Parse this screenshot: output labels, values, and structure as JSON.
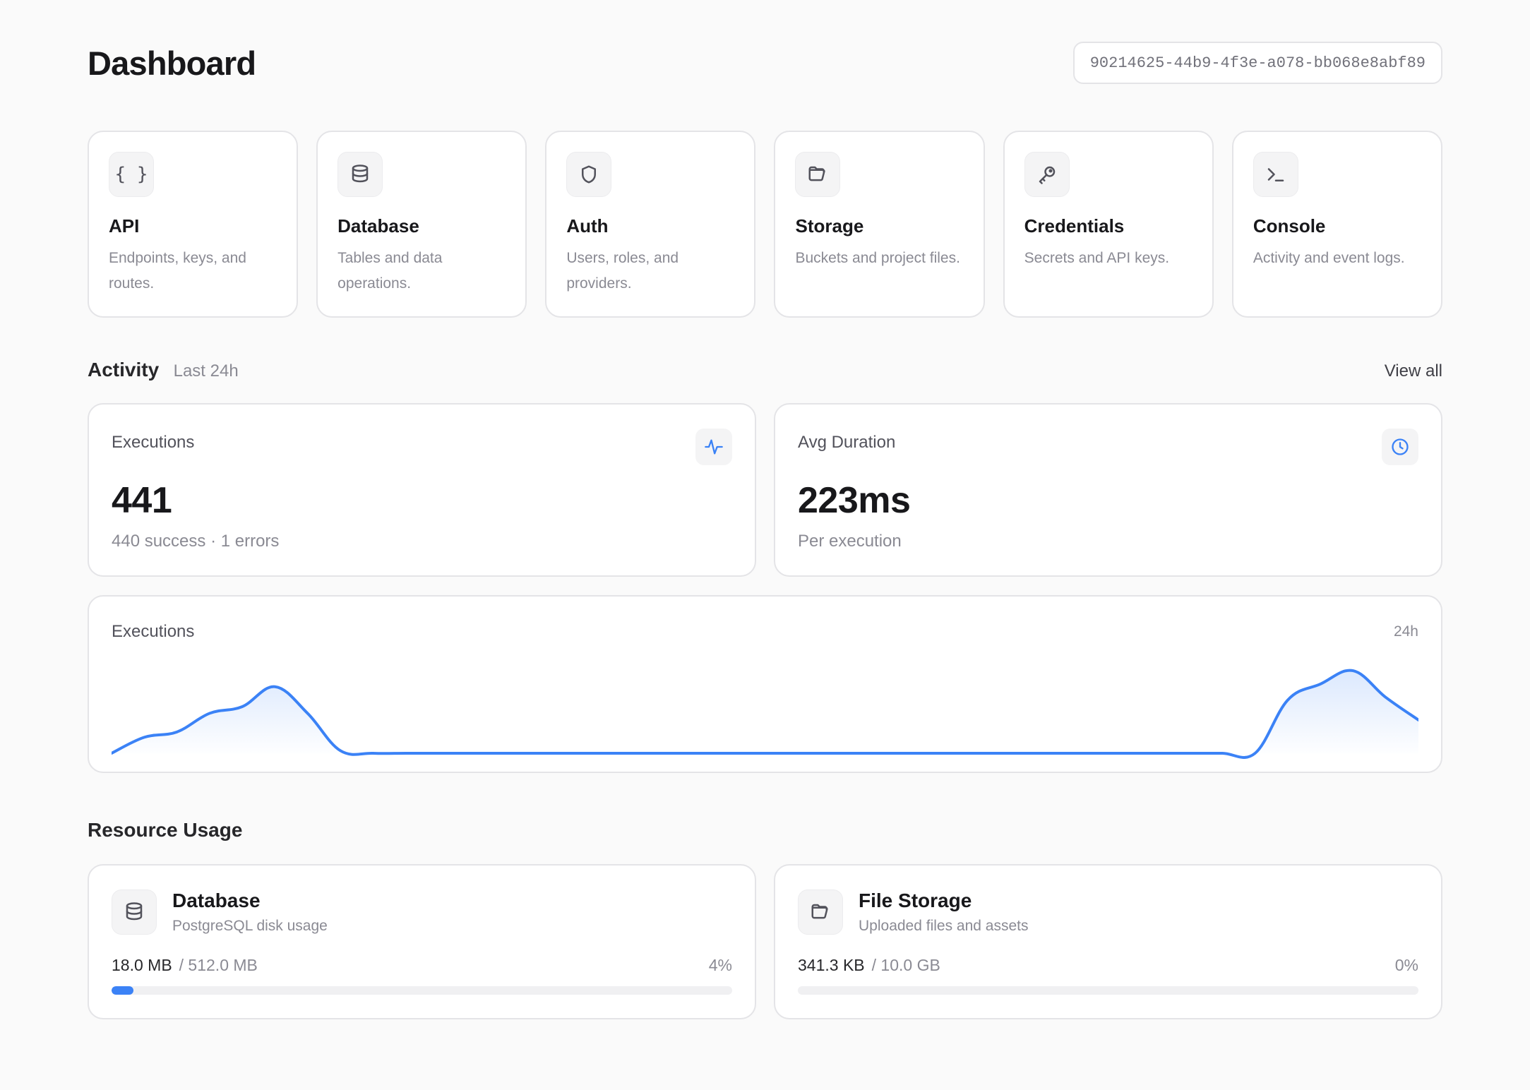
{
  "header": {
    "title": "Dashboard",
    "project_id": "90214625-44b9-4f3e-a078-bb068e8abf89"
  },
  "services": [
    {
      "icon": "braces-icon",
      "glyph": "{ }",
      "title": "API",
      "desc": "Endpoints, keys, and routes."
    },
    {
      "icon": "database-icon",
      "glyph": "",
      "title": "Database",
      "desc": "Tables and data operations."
    },
    {
      "icon": "shield-icon",
      "glyph": "",
      "title": "Auth",
      "desc": "Users, roles, and providers."
    },
    {
      "icon": "folder-open-icon",
      "glyph": "",
      "title": "Storage",
      "desc": "Buckets and project files."
    },
    {
      "icon": "key-icon",
      "glyph": "",
      "title": "Credentials",
      "desc": "Secrets and API keys."
    },
    {
      "icon": "terminal-icon",
      "glyph": "",
      "title": "Console",
      "desc": "Activity and event logs."
    }
  ],
  "activity": {
    "title": "Activity",
    "subtitle": "Last 24h",
    "view_all": "View all",
    "executions": {
      "label": "Executions",
      "icon": "activity-pulse-icon",
      "value": "441",
      "meta": "440 success · 1 errors"
    },
    "avg_duration": {
      "label": "Avg Duration",
      "icon": "clock-icon",
      "value": "223ms",
      "meta": "Per execution"
    },
    "chart": {
      "title": "Executions",
      "range": "24h"
    }
  },
  "chart_data": {
    "type": "area",
    "title": "Executions",
    "xlabel": "",
    "ylabel": "",
    "x": [
      0,
      1,
      2,
      3,
      4,
      5,
      6,
      7,
      8,
      9,
      10,
      11,
      12,
      13,
      14,
      15,
      16,
      17,
      18,
      19,
      20,
      21,
      22,
      23,
      24,
      25,
      26,
      27,
      28,
      29,
      30,
      31,
      32,
      33,
      34,
      35,
      36,
      37,
      38,
      39,
      40
    ],
    "values": [
      0,
      12,
      16,
      30,
      35,
      50,
      30,
      2,
      0,
      0,
      0,
      0,
      0,
      0,
      0,
      0,
      0,
      0,
      0,
      0,
      0,
      0,
      0,
      0,
      0,
      0,
      0,
      0,
      0,
      0,
      0,
      0,
      0,
      0,
      0,
      0,
      40,
      52,
      62,
      42,
      25
    ],
    "ylim": [
      0,
      70
    ],
    "grid": false,
    "color": "#3b82f6"
  },
  "resources": {
    "title": "Resource Usage",
    "database": {
      "icon": "database-icon",
      "title": "Database",
      "subtitle": "PostgreSQL disk usage",
      "used": "18.0 MB",
      "total": "/ 512.0 MB",
      "percent_label": "4%",
      "percent": 3.5
    },
    "file_storage": {
      "icon": "folder-open-icon",
      "title": "File Storage",
      "subtitle": "Uploaded files and assets",
      "used": "341.3 KB",
      "total": "/ 10.0 GB",
      "percent_label": "0%",
      "percent": 0
    }
  },
  "colors": {
    "accent": "#3b82f6",
    "background": "#fafafa",
    "card": "#ffffff",
    "border": "#e4e4e7"
  }
}
